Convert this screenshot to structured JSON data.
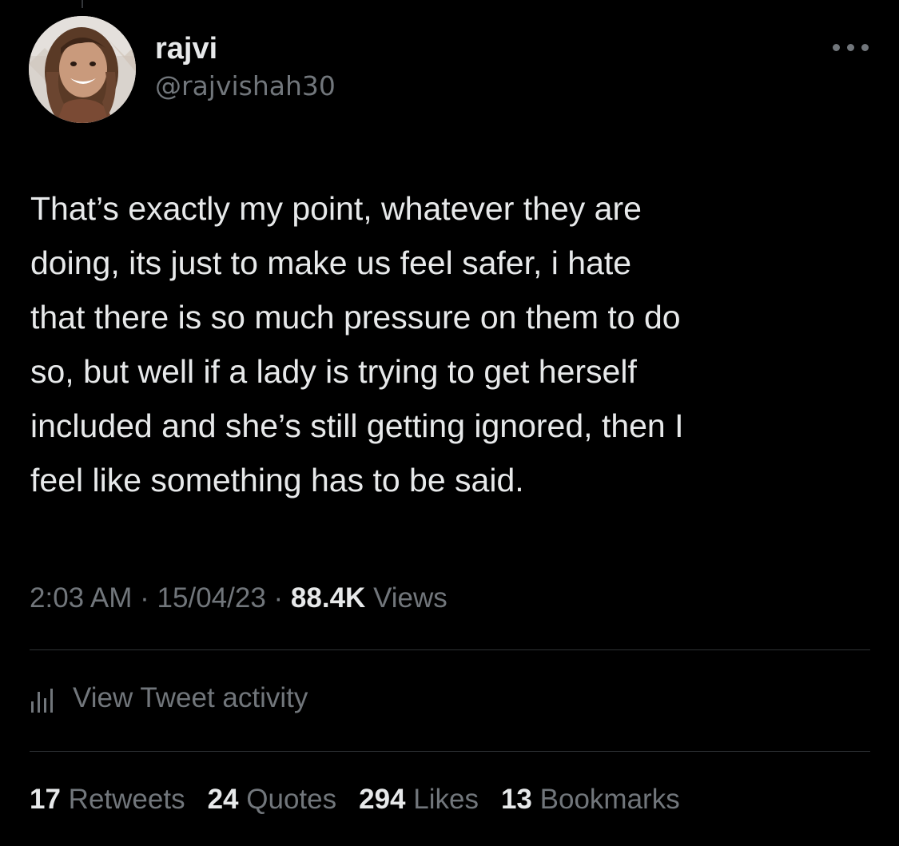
{
  "tweet": {
    "author": {
      "display_name": "rajvi",
      "handle": "@rajvishah30"
    },
    "text": "That’s exactly my point, whatever they are\ndoing, its just to make us feel safer, i hate\nthat there is so much pressure on them to do\nso, but well if a lady is trying to get herself\nincluded and she’s still getting ignored, then I\nfeel like something has to be said.",
    "time": "2:03 AM",
    "date": "15/04/23",
    "separator": "·",
    "views_count": "88.4K",
    "views_label": "Views"
  },
  "activity": {
    "label": "View Tweet activity",
    "icon": "bar-chart-icon"
  },
  "stats": [
    {
      "count": "17",
      "label": "Retweets"
    },
    {
      "count": "24",
      "label": "Quotes"
    },
    {
      "count": "294",
      "label": "Likes"
    },
    {
      "count": "13",
      "label": "Bookmarks"
    }
  ],
  "icons": {
    "more": "more-horizontal-icon"
  },
  "colors": {
    "background": "#000000",
    "primary_text": "#e7e9ea",
    "secondary_text": "#71767b",
    "divider": "#2f3336"
  }
}
